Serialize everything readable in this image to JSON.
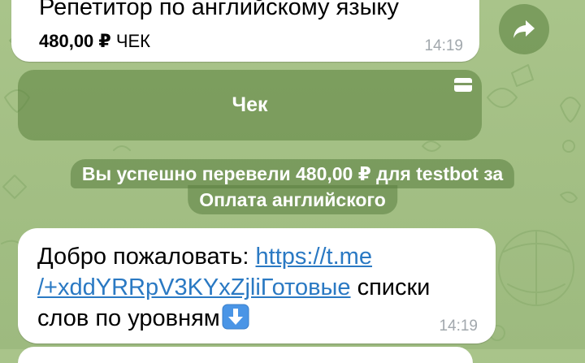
{
  "messages": {
    "top": {
      "title": "Репетитор по английскому языку",
      "amount": "480,00 ₽",
      "label": "ЧЕК",
      "time": "14:19"
    },
    "inline_button": {
      "label": "Чек",
      "icon": "credit-card-icon"
    },
    "service": {
      "line1": "Вы успешно перевели 480,00 ₽ для testbot за",
      "line2": "Оплата английского"
    },
    "welcome": {
      "prefix": "Добро пожаловать: ",
      "link": "https://t.me/+xddYRRpV3KYxZjliГотовые",
      "link_line1": "https://t.me",
      "link_line2": "/+xddYRRpV3KYxZjliГотовые",
      "rest1": " списки",
      "rest2": "слов по уровням",
      "emoji": "⬇️",
      "time": "14:19"
    }
  },
  "colors": {
    "background": "#a9c48a",
    "bubble": "#ffffff",
    "link": "#2a79c3",
    "overlay": "#567d3a",
    "timestamp": "#a2a8ad"
  },
  "icons": {
    "share": "share-forward-icon",
    "card": "credit-card-icon",
    "emoji": "down-arrow-emoji-icon"
  }
}
